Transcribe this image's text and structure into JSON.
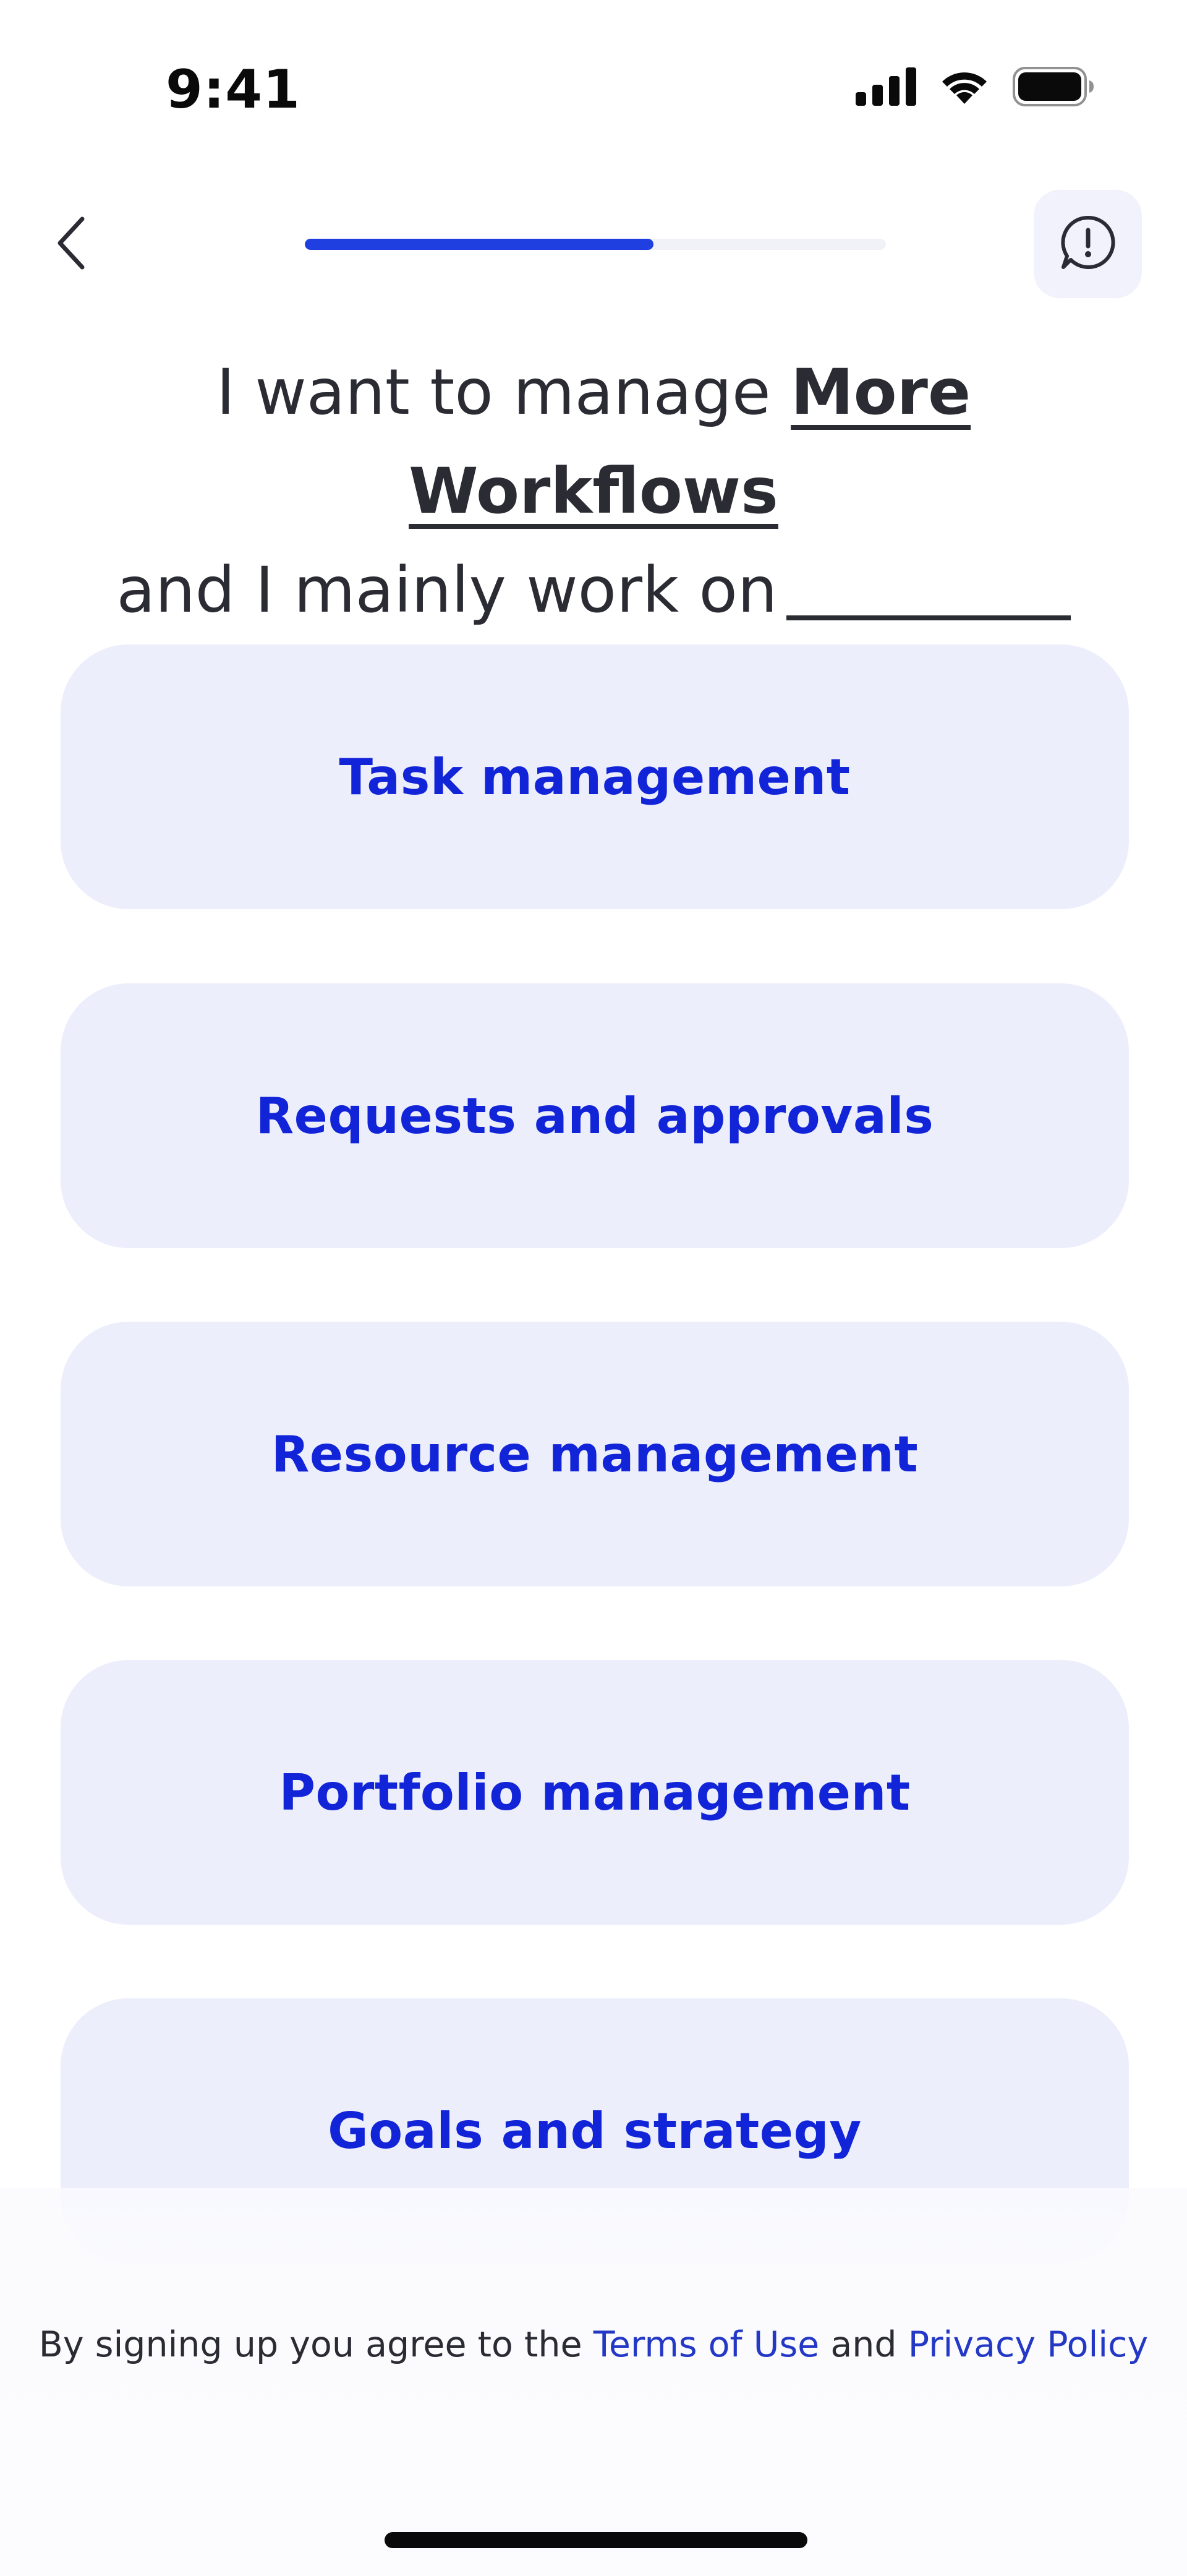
{
  "status_bar": {
    "time": "9:41",
    "icons": [
      "cellular-signal-icon",
      "wifi-icon",
      "battery-icon"
    ]
  },
  "nav": {
    "back_icon": "chevron-left-icon",
    "progress_fraction": 0.6,
    "feedback_icon": "exclamation-bubble-icon"
  },
  "heading": {
    "prefix": "I want to manage",
    "selected_answer": "More Workflows",
    "middle": "and I mainly work on"
  },
  "options": [
    {
      "label": "Task management"
    },
    {
      "label": "Requests and approvals"
    },
    {
      "label": "Resource management"
    },
    {
      "label": "Portfolio management"
    },
    {
      "label": "Goals and strategy"
    }
  ],
  "footer": {
    "text_before": "By signing up you agree to the",
    "terms_link": "Terms of Use",
    "text_middle": "and",
    "privacy_link": "Privacy Policy"
  },
  "colors": {
    "accent": "#1f3fe0",
    "option_background": "#eceefc",
    "option_text": "#1224d8",
    "link": "#2438c6",
    "heading_text": "#2b2b33"
  }
}
